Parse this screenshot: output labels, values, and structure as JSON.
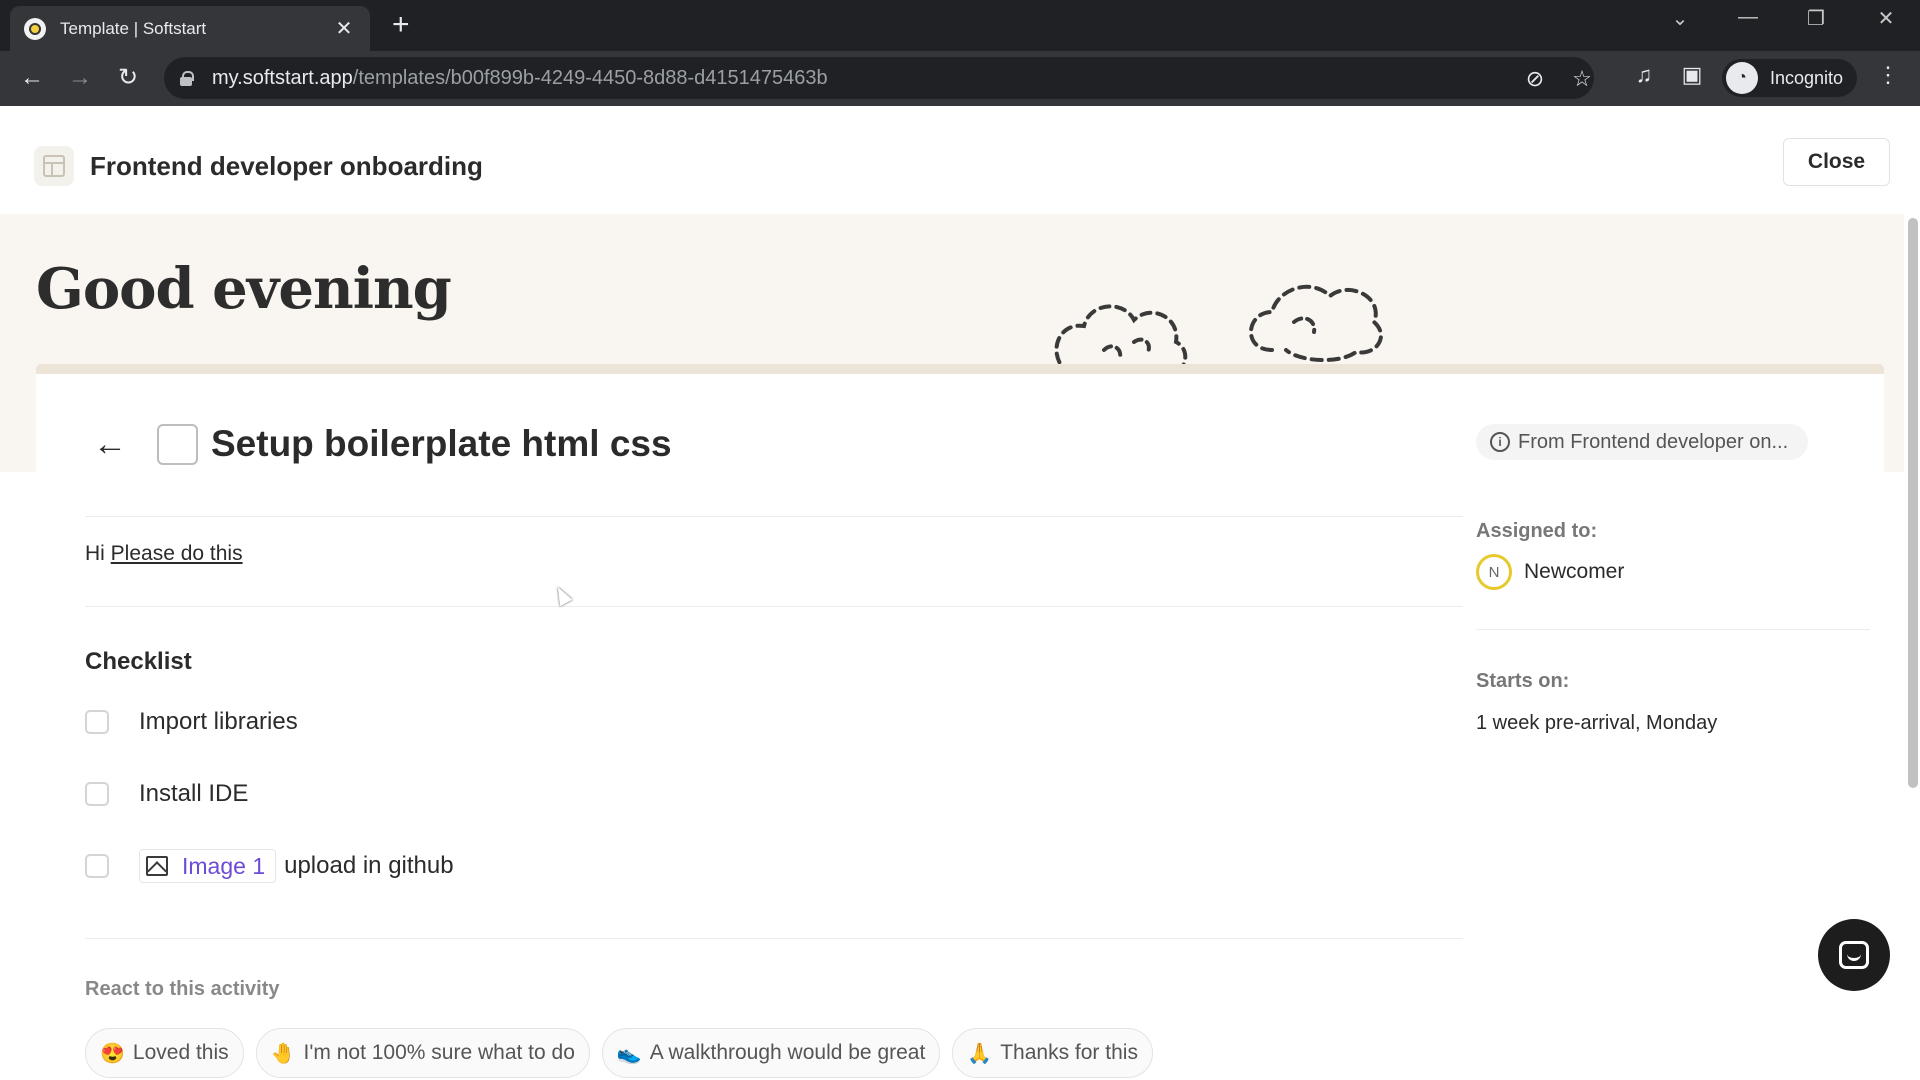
{
  "browser": {
    "tab_title": "Template | Softstart",
    "tab_close": "✕",
    "new_tab": "+",
    "url_host": "my.softstart.app",
    "url_path": "/templates/b00f899b-4249-4450-8d88-d4151475463b",
    "profile_label": "Incognito",
    "icons": [
      "back-icon",
      "forward-icon",
      "reload-icon",
      "lock-icon",
      "eye-off-icon",
      "star-icon",
      "media-icon",
      "sidepanel-icon",
      "incognito-icon",
      "menu-icon"
    ]
  },
  "header": {
    "title": "Frontend developer onboarding",
    "close_label": "Close"
  },
  "banner": {
    "greeting": "Good evening"
  },
  "task": {
    "title": "Setup boilerplate html css",
    "description_prefix": "Hi ",
    "description_link": "Please do this",
    "checklist_title": "Checklist",
    "checklist": [
      {
        "label": "Import libraries",
        "checked": false
      },
      {
        "label": "Install IDE",
        "checked": false
      },
      {
        "attachment": "Image 1",
        "label": "upload in github",
        "checked": false
      }
    ],
    "react_title": "React to this activity",
    "reactions": [
      {
        "emoji": "😍",
        "label": "Loved this"
      },
      {
        "emoji": "🤚",
        "label": "I'm not 100% sure what to do"
      },
      {
        "emoji": "👟",
        "label": "A walkthrough would be great"
      },
      {
        "emoji": "🙏",
        "label": "Thanks for this"
      }
    ]
  },
  "sidebar": {
    "source": "From Frontend developer on...",
    "assigned_label": "Assigned to:",
    "assignee_initial": "N",
    "assignee_name": "Newcomer",
    "starts_label": "Starts on:",
    "starts_value": "1 week pre-arrival, Monday"
  },
  "colors": {
    "banner_bg": "#f9f5f0",
    "link_accent": "#6c4bd6",
    "avatar_ring": "#e8c92b"
  }
}
